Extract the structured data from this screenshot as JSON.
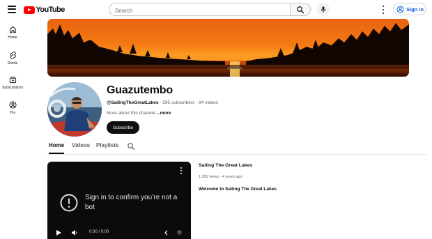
{
  "header": {
    "logo_text": "YouTube",
    "search_placeholder": "Search",
    "sign_in_label": "Sign in"
  },
  "sidebar": {
    "items": [
      {
        "label": "Home",
        "icon": "home-icon"
      },
      {
        "label": "Shorts",
        "icon": "shorts-icon"
      },
      {
        "label": "Subscriptions",
        "icon": "subscriptions-icon"
      },
      {
        "label": "You",
        "icon": "you-icon"
      }
    ]
  },
  "channel": {
    "name": "Guazutembo",
    "handle": "@SailingTheGreatLakes",
    "stats": " · 595 subscribers · 94 videos",
    "about": "More about this channel",
    "more_label": " ...more",
    "subscribe_label": "Subscribe"
  },
  "tabs": [
    {
      "label": "Home",
      "active": true
    },
    {
      "label": "Videos",
      "active": false
    },
    {
      "label": "Playlists",
      "active": false
    }
  ],
  "player": {
    "message": "Sign in to confirm you’re not a bot",
    "timecode": "0:00 / 0:00"
  },
  "video": {
    "title": "Sailing The Great Lakes",
    "stats": "1,952 views · 4 years ago",
    "description": "Welcome to Sailing The Great Lakes"
  },
  "colors": {
    "brand_red": "#ff0000",
    "link_blue": "#065fd4",
    "sunset_orange": "#f26a13",
    "text_primary": "#0f0f0f",
    "text_secondary": "#606060"
  }
}
